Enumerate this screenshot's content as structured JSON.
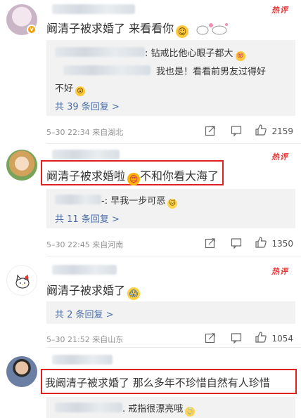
{
  "hot_label": "热评",
  "comments": [
    {
      "text": "阚清子被求婚了 来看看你",
      "emoji": "laugh-cry-emoji",
      "replies": [
        {
          "text": ": 钻戒比他心眼子都大",
          "emoji": "tongue-emoji"
        },
        {
          "text": "我也是！看看前男友过得好",
          "text2": "不好",
          "emoji": "shock-emoji"
        }
      ],
      "more": "共 39 条回复 >",
      "date": "5–30 22:34",
      "location": "来自湖北",
      "likes": "2159"
    },
    {
      "text": "阚清子被求婚啦",
      "text_after": "不和你看大海了",
      "emoji": "heart-eyes-emoji",
      "replies": [
        {
          "text": "-: 早我一步可恶",
          "emoji": "cat-emoji"
        }
      ],
      "more": "共 11 条回复 >",
      "date": "5–30 22:45",
      "location": "来自河南",
      "likes": "1350"
    },
    {
      "text": "阚清子被求婚了",
      "emoji": "scream-emoji",
      "more": "共 2 条回复 >",
      "date": "5–30 21:52",
      "location": "来自山东",
      "likes": "1054"
    },
    {
      "text": "我阚清子被求婚了  那么多年不珍惜自然有人珍惜",
      "replies": [
        {
          "text": ". 戒指很漂亮哦",
          "emoji": "ring-emoji"
        }
      ]
    }
  ],
  "colors": {
    "link": "#4a6ea9",
    "hot": "#e23a3a",
    "highlight": "#e02020",
    "meta": "#939393"
  }
}
